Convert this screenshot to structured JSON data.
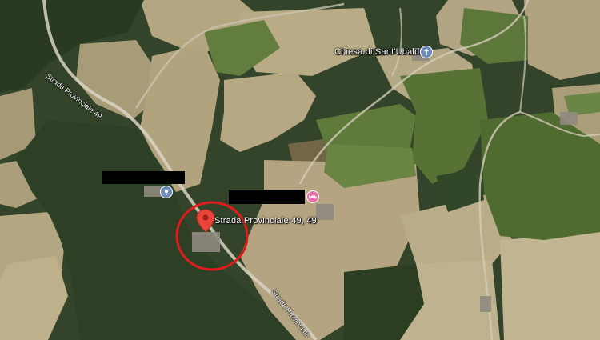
{
  "map": {
    "place_labels": {
      "church": "Chiesa di Sant'Ubaldo",
      "pin_address": "Strada Provinciale 49, 49"
    },
    "road_labels": {
      "upper_left": "Strada Provinciale 49",
      "lower_right": "Strada Provinciale"
    },
    "icons": {
      "church_poi": "church-poi-icon",
      "pin": "location-pin-icon",
      "pin_left_poi": "generic-poi-icon",
      "pink_poi": "lodging-poi-icon"
    },
    "colors": {
      "pin": "#e8453c",
      "circle": "#e01b1b",
      "pink_poi": "#e56ea5",
      "poi_blue": "#6b8bb8"
    }
  }
}
